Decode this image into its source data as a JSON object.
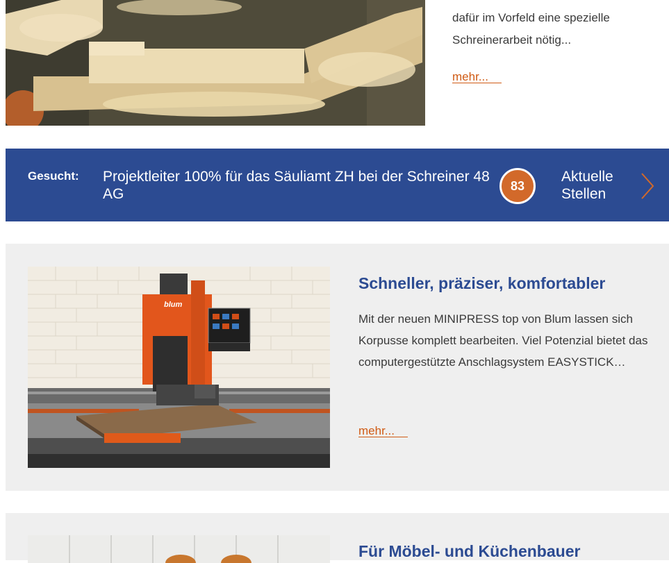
{
  "top_article": {
    "teaser_lines": [
      "dafür im Vorfeld eine spezielle",
      "Schreinerarbeit nötig..."
    ],
    "more_label": "mehr..."
  },
  "job_banner": {
    "label": "Gesucht:",
    "text": "Projektleiter 100% für das Säuliamt ZH bei der Schreiner 48 AG",
    "count": "83",
    "link_label_line1": "Aktuelle",
    "link_label_line2": "Stellen",
    "color": "#2c4b92",
    "badge_color": "#d2692a"
  },
  "article_card": {
    "title": "Schneller, präziser, komfortabler",
    "body": "Mit der neuen MINIPRESS top von Blum lassen sich Korpusse komplett bearbeiten. Viel Potenzial bietet das computergestützte Anschlagsystem EASYSTICK…",
    "more_label": "mehr...",
    "machine_brand": "blum"
  },
  "next_card": {
    "title": "Für Möbel- und Küchenbauer"
  }
}
